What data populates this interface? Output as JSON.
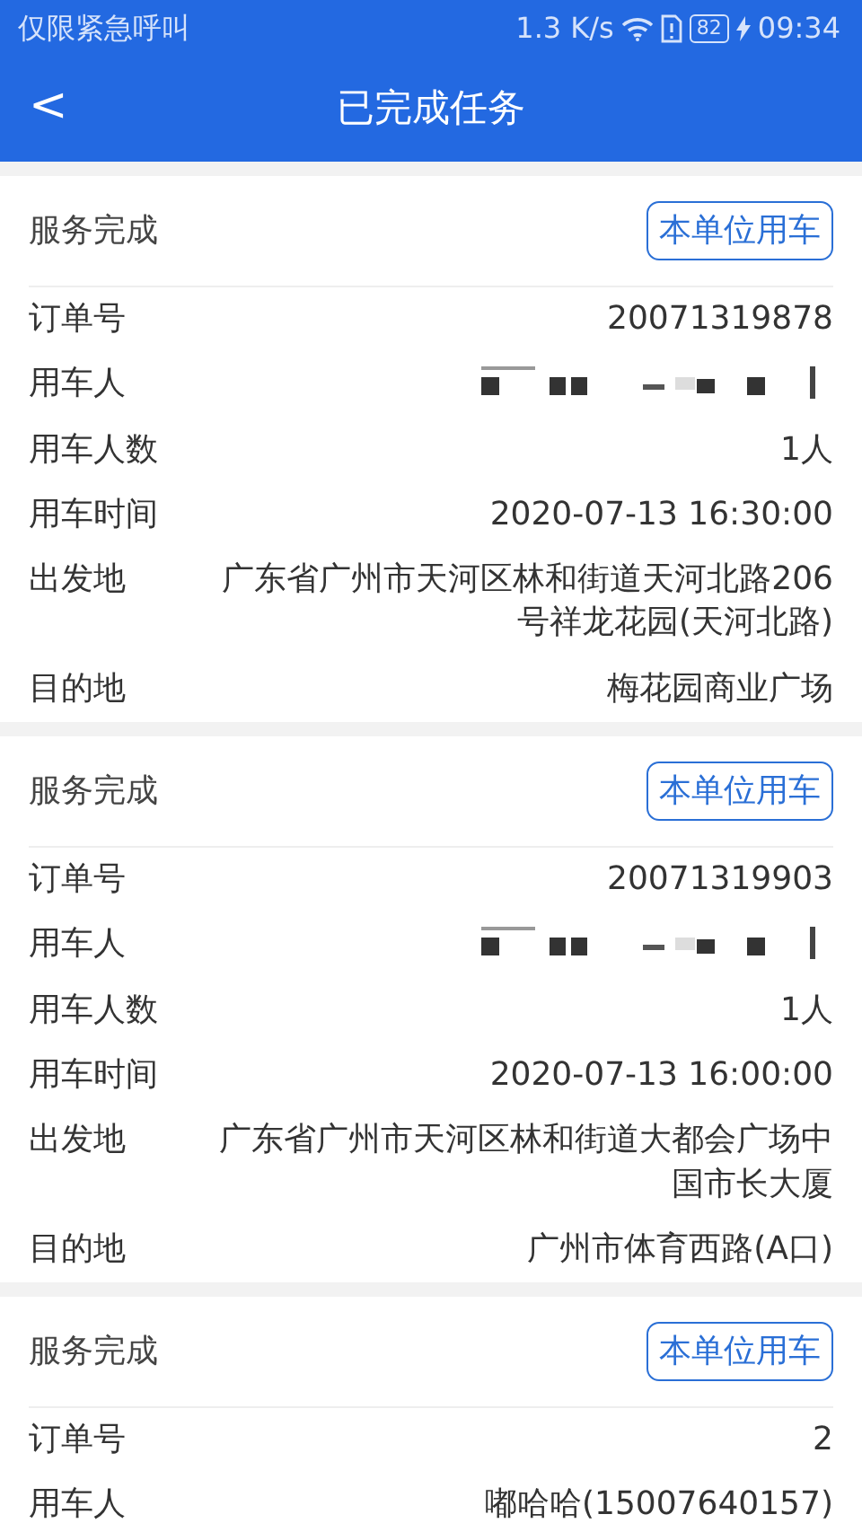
{
  "status_bar": {
    "carrier": "仅限紧急呼叫",
    "speed": "1.3 K/s",
    "battery": "82",
    "time": "09:34"
  },
  "header": {
    "back": "<",
    "title": "已完成任务"
  },
  "orders": [
    {
      "status": "服务完成",
      "tag": "本单位用车",
      "rows": [
        {
          "kind": "text",
          "label": "订单号",
          "value": "20071319878"
        },
        {
          "kind": "masked",
          "label": "用车人"
        },
        {
          "kind": "text",
          "label": "用车人数",
          "value": "1人"
        },
        {
          "kind": "text",
          "label": "用车时间",
          "value": "2020-07-13 16:30:00"
        },
        {
          "kind": "text",
          "label": "出发地",
          "value": "广东省广州市天河区林和街道天河北路206号祥龙花园(天河北路)"
        },
        {
          "kind": "text",
          "label": "目的地",
          "value": "梅花园商业广场"
        }
      ]
    },
    {
      "status": "服务完成",
      "tag": "本单位用车",
      "rows": [
        {
          "kind": "text",
          "label": "订单号",
          "value": "20071319903"
        },
        {
          "kind": "masked",
          "label": "用车人"
        },
        {
          "kind": "text",
          "label": "用车人数",
          "value": "1人"
        },
        {
          "kind": "text",
          "label": "用车时间",
          "value": "2020-07-13 16:00:00"
        },
        {
          "kind": "text",
          "label": "出发地",
          "value": "广东省广州市天河区林和街道大都会广场中国市长大厦"
        },
        {
          "kind": "text",
          "label": "目的地",
          "value": "广州市体育西路(A口)"
        }
      ]
    },
    {
      "status": "服务完成",
      "tag": "本单位用车",
      "rows": [
        {
          "kind": "text",
          "label": "订单号",
          "value": "2"
        },
        {
          "kind": "text",
          "label": "用车人",
          "value": "嘟哈哈(15007640157)"
        }
      ]
    }
  ]
}
